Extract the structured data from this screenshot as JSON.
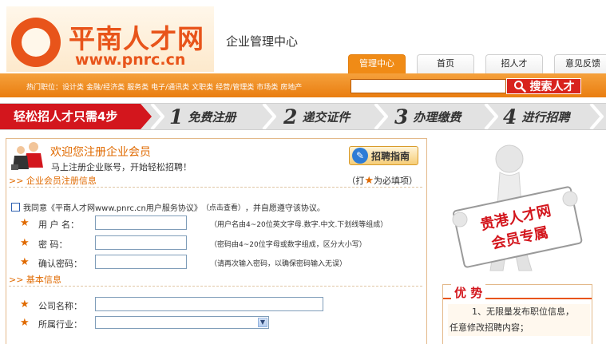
{
  "site": {
    "name": "平南人才网",
    "url": "www.pnrc.cn",
    "section": "企业管理中心"
  },
  "tabs": [
    {
      "label": "管理中心",
      "active": true
    },
    {
      "label": "首页",
      "active": false
    },
    {
      "label": "招人才",
      "active": false
    },
    {
      "label": "意见反馈",
      "active": false
    }
  ],
  "hot_jobs": {
    "lead": "热门职位：",
    "items": [
      "设计类",
      "金融/经济类",
      "服务类",
      "电子/通讯类",
      "文职类",
      "经营/管理类",
      "市场类",
      "房地产"
    ]
  },
  "search": {
    "value": "",
    "placeholder": "",
    "button_label": "搜索人才"
  },
  "steps": {
    "lead": "轻松招人才只需4步",
    "items": [
      {
        "num": "1",
        "label": "免费注册"
      },
      {
        "num": "2",
        "label": "递交证件"
      },
      {
        "num": "3",
        "label": "办理缴费"
      },
      {
        "num": "4",
        "label": "进行招聘"
      }
    ]
  },
  "welcome": {
    "title": "欢迎您注册企业会员",
    "subtitle": "马上注册企业账号，开始轻松招聘！",
    "guide_button": "招聘指南"
  },
  "registration": {
    "section_title": ">> 企业会员注册信息",
    "required_note_prefix": "（打",
    "required_note_star": "★",
    "required_note_suffix": "为必填项）",
    "agree_prefix": "我同意《平南人才网www.pnrc.cn用户服务协议》",
    "agree_click": "（点击查看）",
    "agree_suffix": "，并自愿遵守该协议。",
    "fields": [
      {
        "label": "用  户  名：",
        "value": "",
        "hint": "（用户名由4~20位英文字母.数字.中文.下划线等组成）"
      },
      {
        "label": "密      码：",
        "value": "",
        "hint": "（密码由4~20位字母或数字组成，区分大小写）"
      },
      {
        "label": "确认密码：",
        "value": "",
        "hint": "（请再次输入密码，以确保密码输入无误）"
      }
    ]
  },
  "basic_info": {
    "section_title": ">> 基本信息",
    "company_label": "公司名称：",
    "company_value": "",
    "industry_label": "所属行业：",
    "industry_value": ""
  },
  "promo": {
    "line1": "贵港人才网",
    "line2": "会员专属"
  },
  "advantage": {
    "title": "优 势",
    "line1": "1、无限量发布职位信息，",
    "line2": "任意修改招聘内容；"
  },
  "colors": {
    "brand_orange": "#e8541a",
    "bar_orange": "#e97d10",
    "step_red": "#d3161d"
  }
}
